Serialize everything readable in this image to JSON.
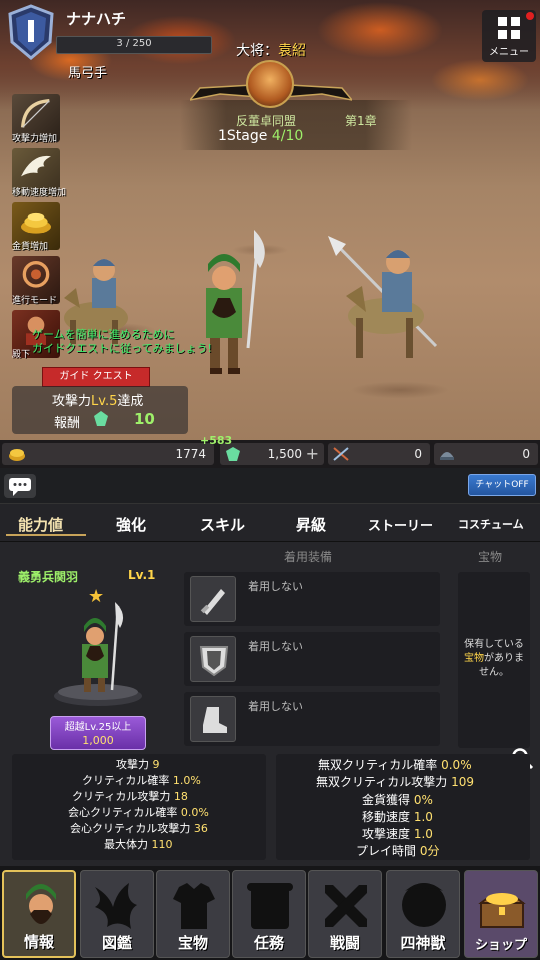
{
  "player": {
    "name": "ナナハチ",
    "exp": "3 / 250"
  },
  "menu": {
    "label": "メニュー"
  },
  "unit_type": "馬弓手",
  "general": {
    "label": "大将：",
    "name": "袁紹"
  },
  "stage": {
    "campaign": "反董卓同盟",
    "chapter": "第1章",
    "stage_label": "1Stage",
    "progress": "4/10"
  },
  "buffs": [
    {
      "label": "攻撃力増加",
      "icon": "bow-icon"
    },
    {
      "label": "移動速度増加",
      "icon": "wing-icon"
    },
    {
      "label": "金貨増加",
      "icon": "gold-icon"
    },
    {
      "label": "進行モード",
      "icon": "mode-icon"
    },
    {
      "label": "殿下",
      "icon": "portrait-icon"
    }
  ],
  "guide": {
    "message_line1": "ゲームを簡単に進めるために",
    "message_line2": "ガイドクエストに従ってみましょう!",
    "ribbon": "ガイド クエスト",
    "task_prefix": "攻撃力",
    "task_lv": "Lv.5",
    "task_suffix": "達成",
    "reward_label": "報酬",
    "reward_value": "10"
  },
  "currency": {
    "gold": "1774",
    "jade": "1,500",
    "jade_bonus": "+583",
    "weapons": "0",
    "scroll": "0"
  },
  "chat": {
    "toggle": "チャットOFF"
  },
  "tabs": [
    "能力値",
    "強化",
    "スキル",
    "昇級",
    "ストーリー",
    "コスチューム"
  ],
  "hero": {
    "name": "義勇兵関羽",
    "level": "Lv.1",
    "ascend_label": "超越Lv.25以上",
    "ascend_cost": "1,000"
  },
  "equipment": {
    "header": "着用装備",
    "slots": [
      "着用しない",
      "着用しない",
      "着用しない"
    ]
  },
  "treasure": {
    "header": "宝物",
    "msg1": "保有している",
    "msg2_hl": "宝物",
    "msg2": "がありま",
    "msg3": "せん。"
  },
  "stats_left": [
    {
      "label": "攻撃力",
      "value": "9"
    },
    {
      "label": "クリティカル確率",
      "value": "1.0%"
    },
    {
      "label": "クリティカル攻撃力",
      "value": "18"
    },
    {
      "label": "会心クリティカル確率",
      "value": "0.0%"
    },
    {
      "label": "会心クリティカル攻撃力",
      "value": "36"
    },
    {
      "label": "最大体力",
      "value": "110"
    }
  ],
  "stats_right": [
    {
      "label": "無双クリティカル確率",
      "value": "0.0%"
    },
    {
      "label": "無双クリティカル攻撃力",
      "value": "109"
    },
    {
      "label": "金貨獲得",
      "value": "0%"
    },
    {
      "label": "移動速度",
      "value": "1.0"
    },
    {
      "label": "攻撃速度",
      "value": "1.0"
    },
    {
      "label": "プレイ時間",
      "value": "0分"
    }
  ],
  "nav": [
    "情報",
    "図鑑",
    "宝物",
    "任務",
    "戦闘",
    "四神獣",
    "ショップ"
  ],
  "colors": {
    "accent_gold": "#c8a45a",
    "highlight_green": "#9ef06a",
    "value_yellow": "#ffe070"
  }
}
